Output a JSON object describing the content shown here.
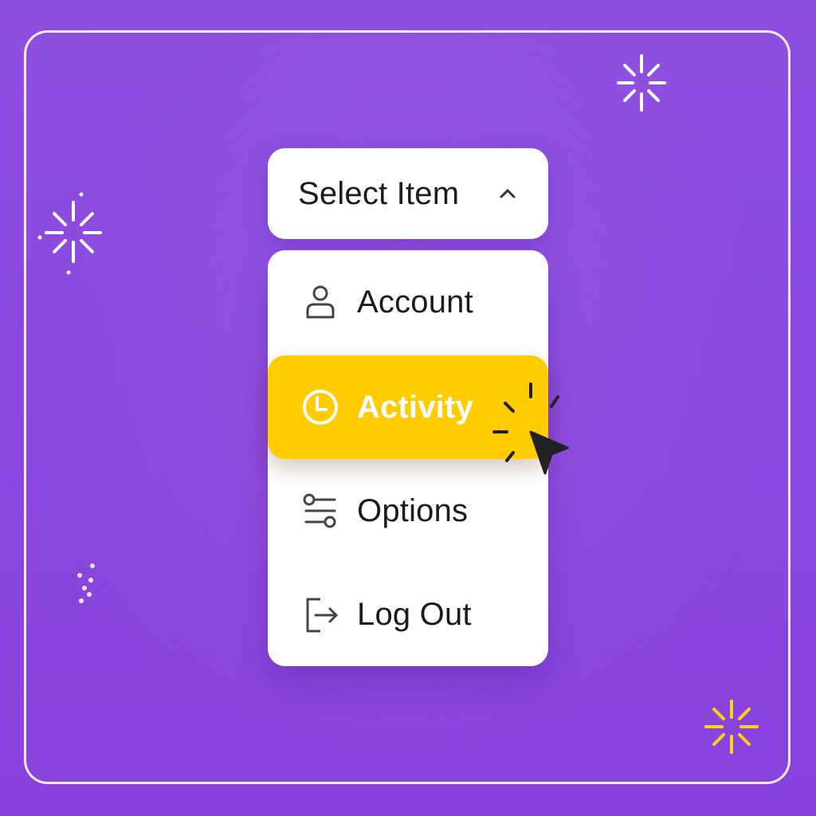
{
  "colors": {
    "background": "#8a48de",
    "frame": "#ffffff",
    "highlight": "#ffcc00",
    "text": "#1c1c1c",
    "sparkle_white": "#ffffff",
    "sparkle_yellow": "#ffd21a"
  },
  "dropdown": {
    "trigger_label": "Select Item",
    "trigger_icon": "chevron-up-icon",
    "items": [
      {
        "label": "Account",
        "icon": "user-icon",
        "selected": false
      },
      {
        "label": "Activity",
        "icon": "clock-icon",
        "selected": true
      },
      {
        "label": "Options",
        "icon": "sliders-icon",
        "selected": false
      },
      {
        "label": "Log Out",
        "icon": "logout-icon",
        "selected": false
      }
    ]
  },
  "decorations": {
    "cursor_icon": "pointer-cursor-icon",
    "sparkles": [
      "sparkle-icon",
      "sparkle-icon",
      "sparkle-icon",
      "sparkle-icon"
    ]
  }
}
